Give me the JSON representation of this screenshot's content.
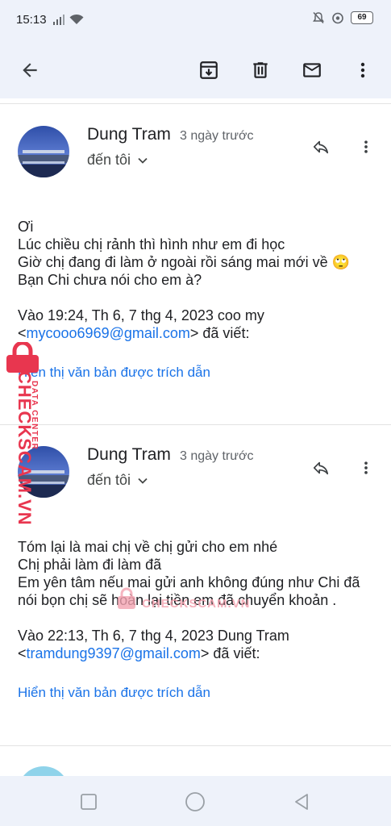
{
  "status_bar": {
    "time": "15:13",
    "battery": "69"
  },
  "app_bar": {
    "back_icon": "arrow-left-icon",
    "archive_icon": "archive-icon",
    "delete_icon": "trash-icon",
    "mark_unread_icon": "mail-icon",
    "more_icon": "more-vert-icon"
  },
  "messages": [
    {
      "sender": "Dung Tram",
      "time": "3 ngày trước",
      "to": "đến tôi",
      "body": [
        "Ơi",
        "Lúc chiều chị rảnh thì hình như em đi học",
        "Giờ chị đang đi làm ở ngoài rồi sáng mai mới về 🙄",
        "Bạn Chi chưa nói cho em à?"
      ],
      "quote_header": "Vào 19:24, Th 6, 7 thg 4, 2023 coo my",
      "quote_email": "mycooo6969@gmail.com",
      "quote_suffix": "đã viết:",
      "show_quoted": "Hiển thị văn bản được trích dẫn"
    },
    {
      "sender": "Dung Tram",
      "time": "3 ngày trước",
      "to": "đến tôi",
      "body": [
        "Tóm lại là mai chị về chị gửi cho em nhé",
        "Chị phải làm đi làm đã",
        "Em yên tâm nếu mai gửi anh không đúng như Chi đã",
        "nói bọn chị sẽ hoàn lại tiền em đã chuyển khoản ."
      ],
      "quote_header": "Vào 22:13, Th 6, 7 thg 4, 2023 Dung Tram",
      "quote_email": "tramdung9397@gmail.com",
      "quote_suffix": "đã viết:",
      "show_quoted": "Hiển thị văn bản được trích dẫn"
    }
  ],
  "watermark": {
    "side_brand": "CHECKSCAM.VN",
    "side_sub": "DATA CENTER",
    "center_brand": "CHECKSCAM.VN"
  },
  "nav_bar": {
    "recent_icon": "square-icon",
    "home_icon": "circle-icon",
    "back_icon": "triangle-back-icon"
  }
}
